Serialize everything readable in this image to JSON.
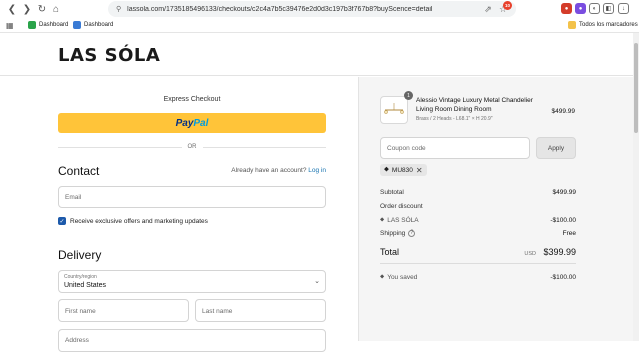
{
  "browser": {
    "url": "lassola.com/1735185496133/checkouts/c2c4a7b5c39476e2d0d3c197b3f767b8?buyScence=detail",
    "bookmarks": [
      "Dashboard",
      "Dashboard"
    ],
    "all_bookmarks": "Todos los marcadores",
    "ext_badge": "10"
  },
  "store": {
    "logo": "LAS SÓLA"
  },
  "checkout": {
    "express_title": "Express Checkout",
    "paypal_part1": "Pay",
    "paypal_part2": "Pal",
    "or_text": "OR",
    "contact_title": "Contact",
    "account_prompt": "Already have an account?",
    "login_link": "Log in",
    "email_placeholder": "Email",
    "offers_label": "Receive exclusive offers and marketing updates",
    "offers_checked": true,
    "delivery_title": "Delivery",
    "country_label": "Country/region",
    "country_value": "United States",
    "first_name_placeholder": "First name",
    "last_name_placeholder": "Last name",
    "address_placeholder": "Address"
  },
  "summary": {
    "product": {
      "quantity": "1",
      "name": "Alessio Vintage Luxury Metal Chandelier Living Room Dining Room",
      "variant": "Brass / 2 Heads - L68.1\" × H 20.9\"",
      "price": "$499.99"
    },
    "coupon_placeholder": "Coupon code",
    "apply_label": "Apply",
    "applied_code": "MU830",
    "subtotal_label": "Subtotal",
    "subtotal_value": "$499.99",
    "order_discount_label": "Order discount",
    "discount_name": "LAS SÓLA",
    "discount_value": "-$100.00",
    "shipping_label": "Shipping",
    "shipping_value": "Free",
    "total_label": "Total",
    "currency": "USD",
    "total_value": "$399.99",
    "saved_label": "You saved",
    "saved_value": "-$100.00"
  },
  "colors": {
    "paypal_yellow": "#ffc439",
    "link_blue": "#1773b0",
    "checkbox_blue": "#1d5aab"
  }
}
